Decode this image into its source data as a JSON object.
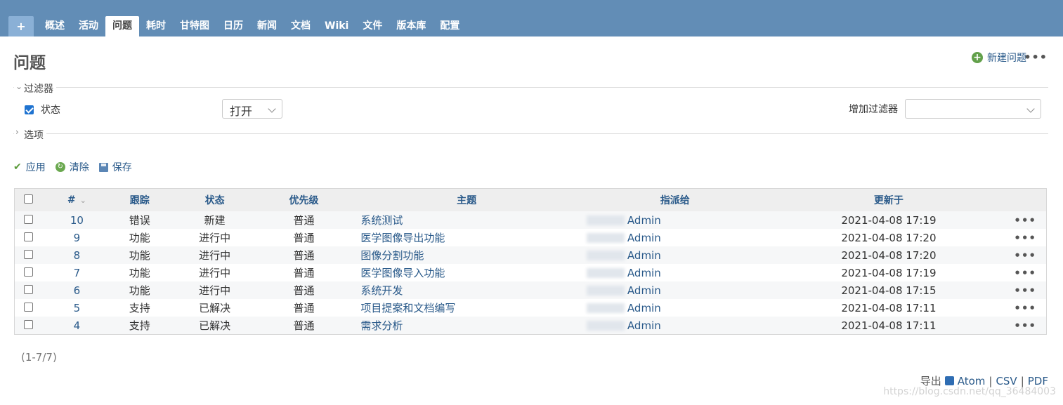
{
  "tabs": [
    {
      "label": "+",
      "active": false
    },
    {
      "label": "概述",
      "active": false
    },
    {
      "label": "活动",
      "active": false
    },
    {
      "label": "问题",
      "active": true
    },
    {
      "label": "耗时",
      "active": false
    },
    {
      "label": "甘特图",
      "active": false
    },
    {
      "label": "日历",
      "active": false
    },
    {
      "label": "新闻",
      "active": false
    },
    {
      "label": "文档",
      "active": false
    },
    {
      "label": "Wiki",
      "active": false
    },
    {
      "label": "文件",
      "active": false
    },
    {
      "label": "版本库",
      "active": false
    },
    {
      "label": "配置",
      "active": false
    }
  ],
  "page_title": "问题",
  "new_issue_label": "新建问题",
  "more_label": "•••",
  "filters": {
    "legend": "过滤器",
    "status_label": "状态",
    "status_checked": true,
    "status_operator": "打开",
    "add_filter_label": "增加过滤器",
    "add_filter_value": ""
  },
  "options_legend": "选项",
  "actions": {
    "apply": "应用",
    "clear": "清除",
    "save": "保存"
  },
  "table": {
    "headers": [
      "#",
      "跟踪",
      "状态",
      "优先级",
      "主题",
      "指派给",
      "更新于"
    ],
    "rows": [
      {
        "id": "10",
        "tracker": "错误",
        "status": "新建",
        "priority": "普通",
        "subject": "系统测试",
        "assignee": "Admin",
        "updated": "2021-04-08 17:19"
      },
      {
        "id": "9",
        "tracker": "功能",
        "status": "进行中",
        "priority": "普通",
        "subject": "医学图像导出功能",
        "assignee": "Admin",
        "updated": "2021-04-08 17:20"
      },
      {
        "id": "8",
        "tracker": "功能",
        "status": "进行中",
        "priority": "普通",
        "subject": "图像分割功能",
        "assignee": "Admin",
        "updated": "2021-04-08 17:20"
      },
      {
        "id": "7",
        "tracker": "功能",
        "status": "进行中",
        "priority": "普通",
        "subject": "医学图像导入功能",
        "assignee": "Admin",
        "updated": "2021-04-08 17:19"
      },
      {
        "id": "6",
        "tracker": "功能",
        "status": "进行中",
        "priority": "普通",
        "subject": "系统开发",
        "assignee": "Admin",
        "updated": "2021-04-08 17:15"
      },
      {
        "id": "5",
        "tracker": "支持",
        "status": "已解决",
        "priority": "普通",
        "subject": "项目提案和文档编写",
        "assignee": "Admin",
        "updated": "2021-04-08 17:11"
      },
      {
        "id": "4",
        "tracker": "支持",
        "status": "已解决",
        "priority": "普通",
        "subject": "需求分析",
        "assignee": "Admin",
        "updated": "2021-04-08 17:11"
      }
    ]
  },
  "pagination": "(1-7/7)",
  "export": {
    "label": "导出",
    "atom": "Atom",
    "csv": "CSV",
    "pdf": "PDF"
  },
  "watermark": "https://blog.csdn.net/qq_36484003",
  "colors": {
    "topbar": "#628db6",
    "link": "#2a5a8a",
    "add_green": "#62a04a"
  }
}
